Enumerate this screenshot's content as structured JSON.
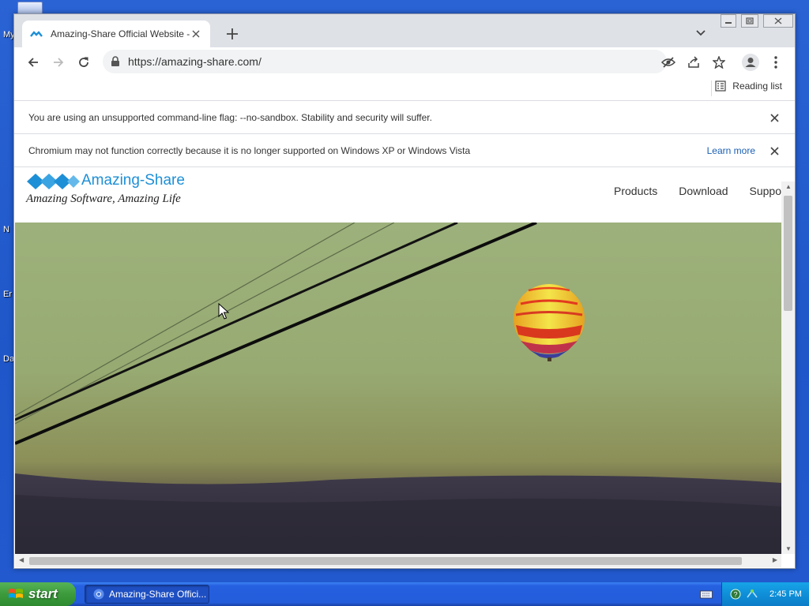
{
  "desktop": {
    "fragments": [
      "My",
      "N",
      "Er",
      "Da"
    ]
  },
  "browser": {
    "tab_title": "Amazing-Share Official Website - Fo",
    "url": "https://amazing-share.com/",
    "reading_list_label": "Reading list"
  },
  "infobars": [
    {
      "message": "You are using an unsupported command-line flag: --no-sandbox. Stability and security will suffer."
    },
    {
      "message": "Chromium may not function correctly because it is no longer supported on Windows XP or Windows Vista",
      "link": "Learn more"
    }
  ],
  "site": {
    "brand": "Amazing-Share",
    "tagline": "Amazing Software, Amazing Life",
    "nav": [
      "Products",
      "Download",
      "Suppo"
    ],
    "accent": "#1d8fd6"
  },
  "taskbar": {
    "start_label": "start",
    "task_item": "Amazing-Share Offici...",
    "clock": "2:45 PM"
  },
  "icons": {
    "back": "arrow-left-icon",
    "forward": "arrow-right-icon",
    "reload": "reload-icon",
    "lock": "lock-icon",
    "eye_off": "eye-off-icon",
    "share": "share-icon",
    "star": "star-icon",
    "profile": "profile-icon",
    "menu": "kebab-menu-icon"
  }
}
